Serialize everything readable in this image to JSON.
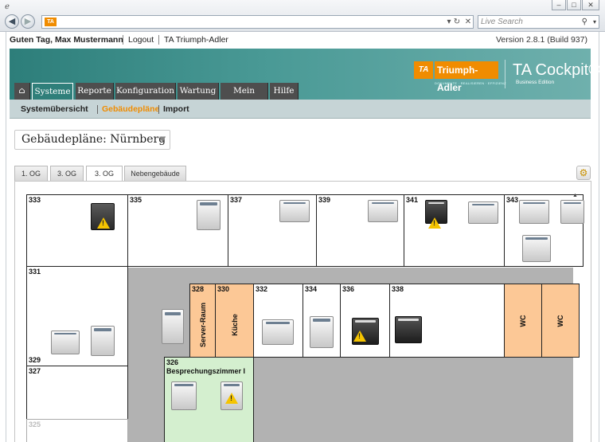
{
  "browser": {
    "search_placeholder": "Live Search"
  },
  "userbar": {
    "greeting": "Guten Tag, Max Mustermann",
    "logout": "Logout",
    "company": "TA Triumph-Adler",
    "version": "Version 2.8.1 (Build 937)"
  },
  "header": {
    "logo_badge": "TA",
    "logo_name": "Triumph-Adler",
    "logo_tagline": "DOKUMENTE · REALISIEREN · EFFIZIENZ",
    "product": "TA Cockpit®",
    "edition": "Business Edition"
  },
  "main_tabs": {
    "home_icon": "home-icon",
    "systeme": "Systeme",
    "reporte": "Reporte",
    "konfiguration": "Konfiguration",
    "wartung": "Wartung",
    "mein_konto": "Mein Konto",
    "hilfe": "Hilfe",
    "active": "Systeme"
  },
  "sub_nav": {
    "systemuebersicht": "Systemübersicht",
    "gebaeudeplaene": "Gebäudepläne",
    "import": "Import",
    "active": "Gebäudepläne"
  },
  "plan_select": {
    "value": "Gebäudepläne: Nürnberg"
  },
  "floor_tabs": {
    "tab1": "1. OG",
    "tab2": "3. OG",
    "tab3": "3. OG",
    "tab4": "Nebengebäude",
    "active": "3. OG (third tab)"
  },
  "rooms": {
    "r333": "333",
    "r335": "335",
    "r337": "337",
    "r339": "339",
    "r341": "341",
    "r343": "343",
    "r331": "331",
    "r329": "329",
    "r327": "327",
    "r325": "325",
    "r328": "328",
    "r328_label": "Server-Raum",
    "r330": "330",
    "r330_label": "Küche",
    "r332": "332",
    "r334": "334",
    "r336": "336",
    "r338": "338",
    "wc1": "WC",
    "wc2": "WC",
    "r326": "326",
    "r326_label": "Besprechungszimmer I"
  },
  "colors": {
    "accent_orange": "#f08c00",
    "header_teal": "#2d7e7a",
    "room_orange": "#fcc896",
    "room_green": "#d4efcf",
    "corridor_gray": "#b2b2b2"
  }
}
